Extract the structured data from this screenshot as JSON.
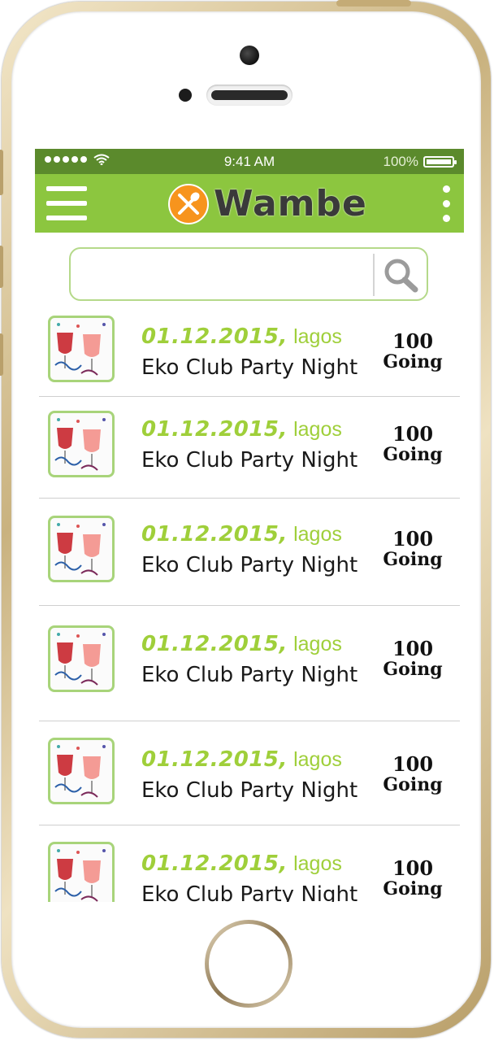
{
  "status_bar": {
    "time": "9:41 AM",
    "battery": "100%"
  },
  "app_bar": {
    "logo_text": "Wambe"
  },
  "search": {
    "placeholder": "",
    "value": ""
  },
  "events": [
    {
      "date": "01.12.2015,",
      "city": "lagos",
      "title": "Eko Club Party Night",
      "count": "100",
      "going_label": "Going"
    },
    {
      "date": "01.12.2015,",
      "city": "lagos",
      "title": "Eko Club Party Night",
      "count": "100",
      "going_label": "Going"
    },
    {
      "date": "01.12.2015,",
      "city": "lagos",
      "title": "Eko Club Party Night",
      "count": "100",
      "going_label": "Going"
    },
    {
      "date": "01.12.2015,",
      "city": "lagos",
      "title": "Eko Club Party Night",
      "count": "100",
      "going_label": "Going"
    },
    {
      "date": "01.12.2015,",
      "city": "lagos",
      "title": "Eko Club Party Night",
      "count": "100",
      "going_label": "Going"
    },
    {
      "date": "01.12.2015,",
      "city": "lagos",
      "title": "Eko Club Party Night",
      "count": "100",
      "going_label": "Going"
    }
  ],
  "colors": {
    "status_bar": "#5b8a2c",
    "app_bar": "#8cc63f",
    "accent_text": "#9fcf3a",
    "logo_badge": "#f7941d"
  }
}
